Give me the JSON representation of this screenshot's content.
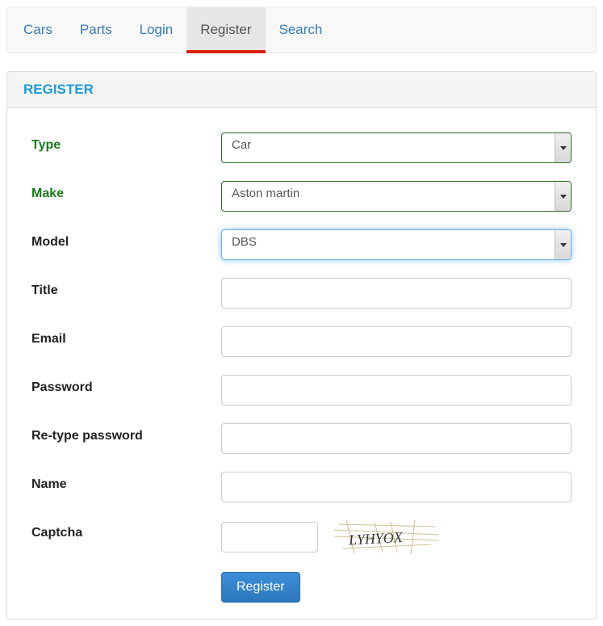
{
  "nav": {
    "items": [
      {
        "label": "Cars"
      },
      {
        "label": "Parts"
      },
      {
        "label": "Login"
      },
      {
        "label": "Register",
        "active": true
      },
      {
        "label": "Search"
      }
    ]
  },
  "panel": {
    "heading": "REGISTER"
  },
  "form": {
    "type": {
      "label": "Type",
      "value": "Car"
    },
    "make": {
      "label": "Make",
      "value": "Aston martin"
    },
    "model": {
      "label": "Model",
      "value": "DBS"
    },
    "title": {
      "label": "Title",
      "value": ""
    },
    "email": {
      "label": "Email",
      "value": ""
    },
    "password": {
      "label": "Password",
      "value": ""
    },
    "rePassword": {
      "label": "Re-type password",
      "value": ""
    },
    "name": {
      "label": "Name",
      "value": ""
    },
    "captcha": {
      "label": "Captcha",
      "value": "",
      "image_text": "LYHYOX"
    },
    "submit": {
      "label": "Register"
    }
  }
}
